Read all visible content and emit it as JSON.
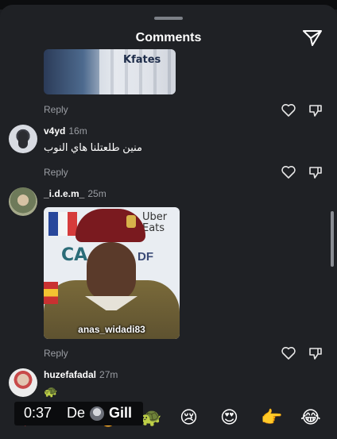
{
  "header": {
    "title": "Comments",
    "share_icon": "paper-plane-icon"
  },
  "comments": [
    {
      "id": "c0",
      "image_text": "Kfates",
      "reply_label": "Reply"
    },
    {
      "id": "c1",
      "username": "v4yd",
      "time": "16m",
      "text": "منين طلعتلنا هاي النوب",
      "reply_label": "Reply"
    },
    {
      "id": "c2",
      "username": "_i.d.e.m_",
      "time": "25m",
      "image_text": {
        "uber": "Uber\nEats",
        "ca": "CA",
        "df": "DF",
        "watermark": "anas_widadi83"
      },
      "reply_label": "Reply"
    },
    {
      "id": "c3",
      "username": "huzefafadal",
      "time": "27m",
      "text": "🐢"
    }
  ],
  "emoji_bar": [
    "❤️",
    "🙌",
    "🔥",
    "🐢",
    "😢",
    "😍",
    "👉",
    "😂"
  ],
  "video_overlay": {
    "time": "0:37",
    "prefix": "De",
    "name": "Gill"
  },
  "colors": {
    "background": "#1f2125",
    "muted_text": "#9a9da3",
    "accent": "#ffffff"
  }
}
